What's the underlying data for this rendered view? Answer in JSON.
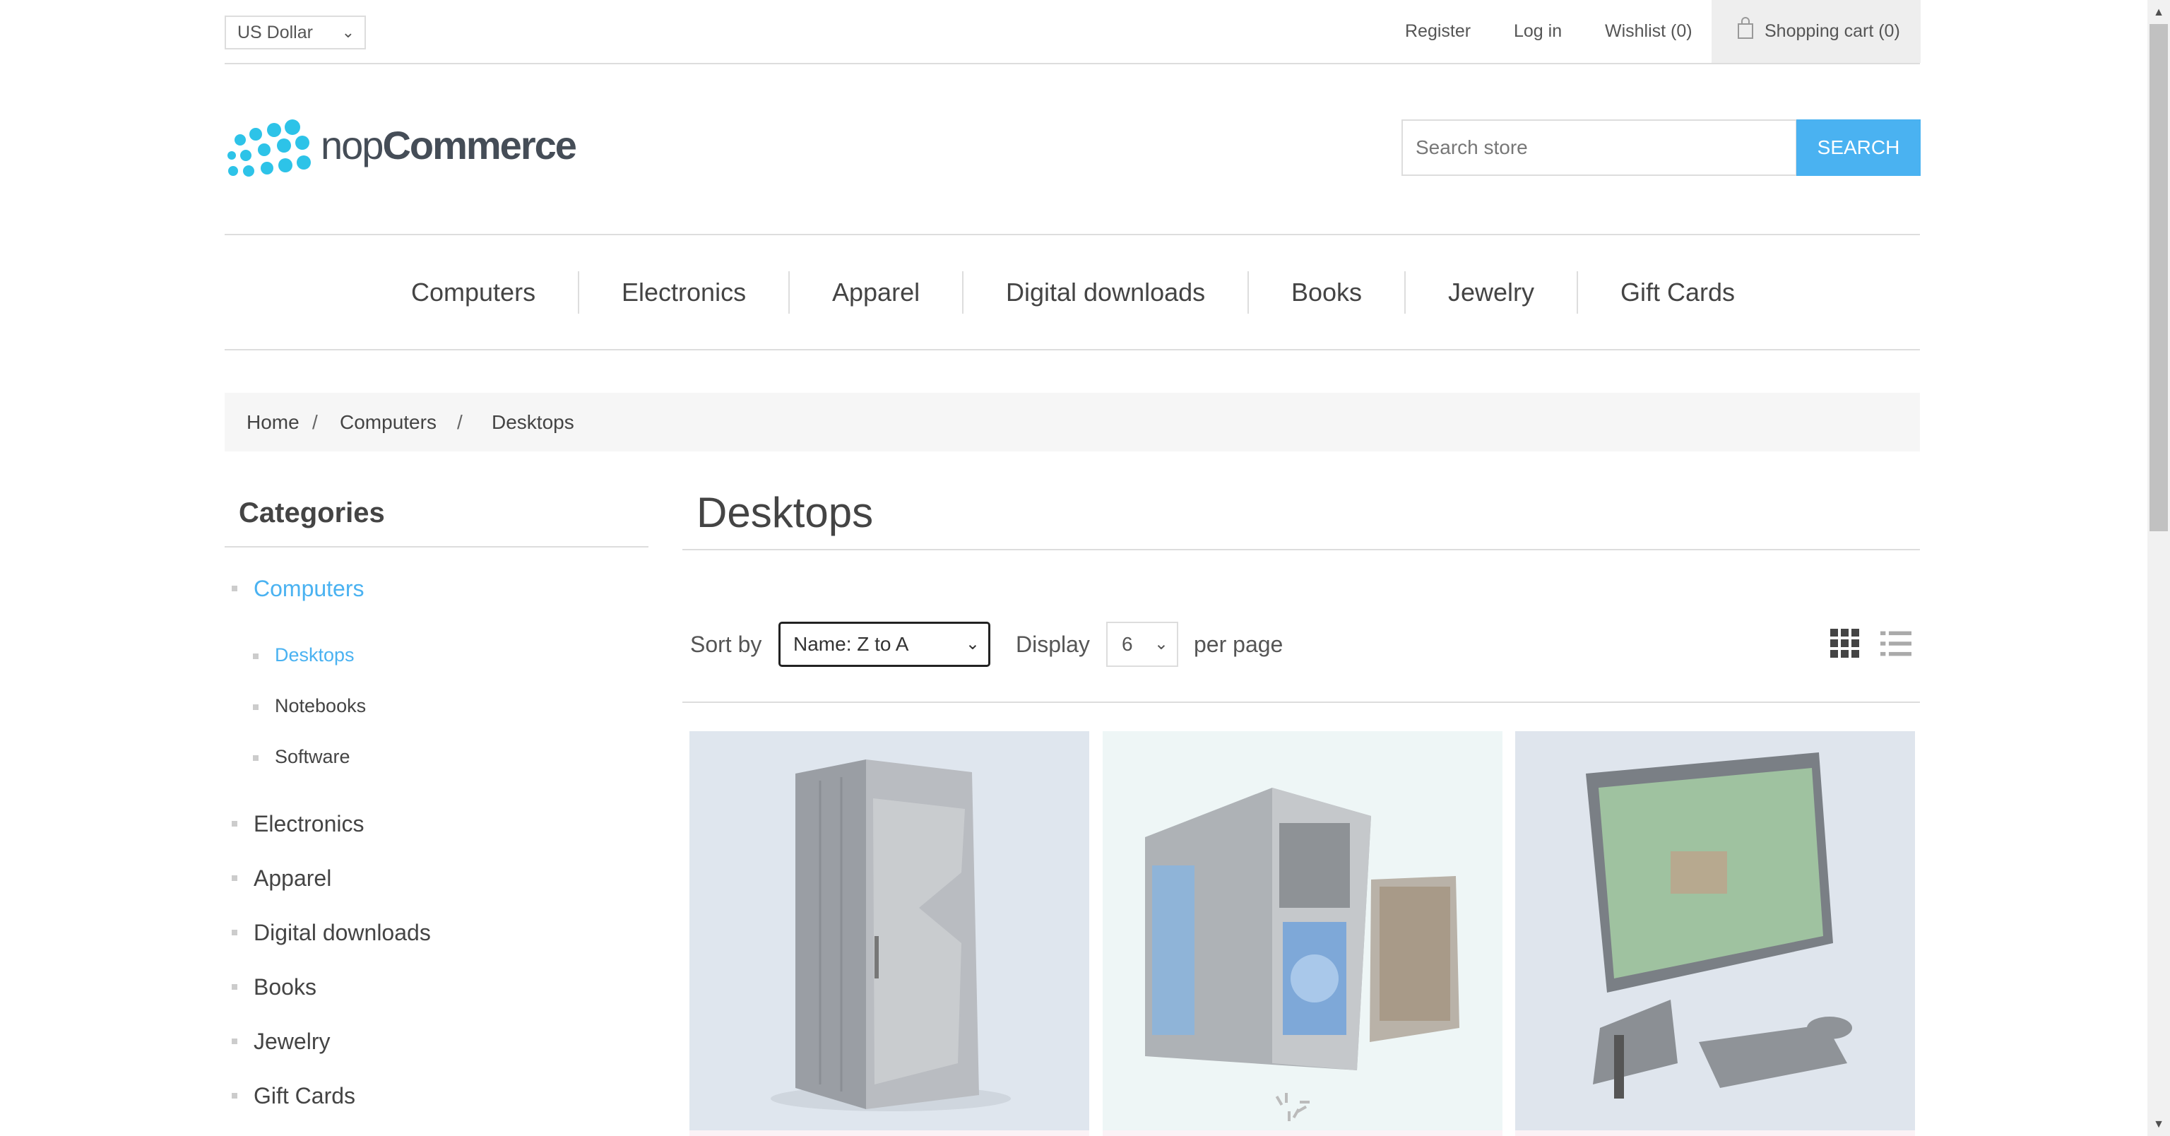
{
  "header": {
    "currency_selected": "US Dollar",
    "links": {
      "register": "Register",
      "login": "Log in",
      "wishlist": "Wishlist (0)",
      "cart": "Shopping cart (0)"
    }
  },
  "logo": {
    "light": "nop",
    "bold": "Commerce"
  },
  "search": {
    "placeholder": "Search store",
    "button": "SEARCH"
  },
  "nav": [
    "Computers",
    "Electronics",
    "Apparel",
    "Digital downloads",
    "Books",
    "Jewelry",
    "Gift Cards"
  ],
  "breadcrumb": {
    "home": "Home",
    "computers": "Computers",
    "current": "Desktops",
    "separator": "/"
  },
  "sidebar": {
    "title": "Categories",
    "items": [
      {
        "label": "Computers",
        "active": true
      },
      {
        "label": "Desktops",
        "active": true
      },
      {
        "label": "Notebooks"
      },
      {
        "label": "Software"
      },
      {
        "label": "Electronics"
      },
      {
        "label": "Apparel"
      },
      {
        "label": "Digital downloads"
      },
      {
        "label": "Books"
      },
      {
        "label": "Jewelry"
      },
      {
        "label": "Gift Cards"
      }
    ]
  },
  "main": {
    "title": "Desktops",
    "sort_label": "Sort by",
    "sort_selected": "Name: Z to A",
    "display_label": "Display",
    "display_selected": "6",
    "per_page_label": "per page",
    "view_modes": [
      "grid-icon",
      "list-icon"
    ]
  },
  "products": [
    {
      "image": "server-tower-product-image"
    },
    {
      "image": "gaming-pc-with-monitor-product-image"
    },
    {
      "image": "all-in-one-desktop-product-image"
    }
  ],
  "colors": {
    "accent": "#4ab2f1",
    "text": "#444444",
    "divider": "#dddddd"
  }
}
